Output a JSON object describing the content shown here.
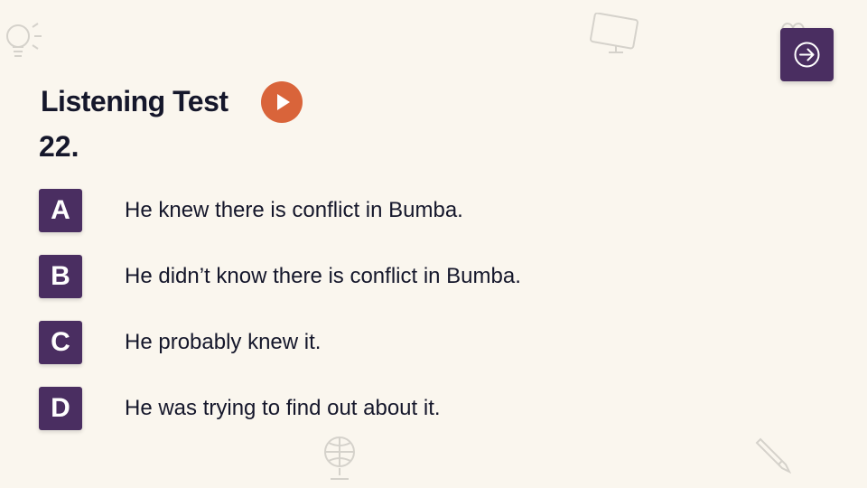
{
  "title": "Listening Test",
  "question_number": "22.",
  "options": [
    {
      "letter": "A",
      "text": "He knew there is conflict in Bumba."
    },
    {
      "letter": "B",
      "text": "He didn’t know there is conflict in Bumba."
    },
    {
      "letter": "C",
      "text": "He probably knew it."
    },
    {
      "letter": "D",
      "text": "He was trying to find out about it."
    }
  ],
  "icons": {
    "play": "play-icon",
    "next": "arrow-right-circle-icon",
    "decorations": [
      "lightbulb-icon",
      "monitor-icon",
      "heart-icon",
      "globe-icon",
      "pencil-icon"
    ]
  },
  "colors": {
    "background": "#faf6ee",
    "accent_purple": "#4a2e61",
    "play_orange": "#d9643a",
    "text": "#15172b"
  }
}
